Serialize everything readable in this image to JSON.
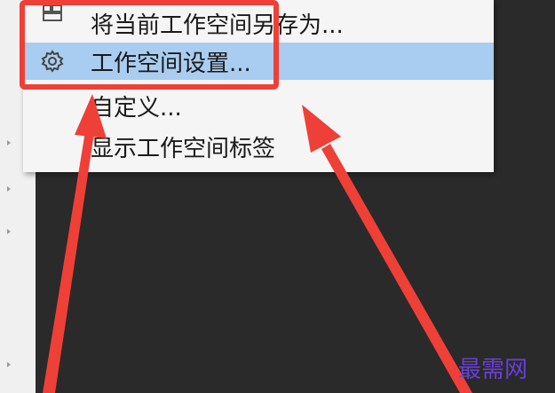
{
  "menu": {
    "items": [
      {
        "label": "将当前工作空间另存为...",
        "icon": "save-workspace-icon",
        "state": "partially-visible"
      },
      {
        "label": "工作空间设置...",
        "icon": "gear-icon",
        "state": "highlighted"
      },
      {
        "label": "自定义...",
        "icon": "",
        "state": "normal"
      },
      {
        "label": "显示工作空间标签",
        "icon": "",
        "state": "normal"
      }
    ]
  },
  "annotations": {
    "box_color": "#ee4037",
    "arrow_color": "#ee4037"
  },
  "colors": {
    "menu_background": "#f5f5f5",
    "highlight": "#a9cdf0",
    "canvas_background": "#2a2a2a"
  },
  "watermark": {
    "text": "最需网",
    "color": "#6a3fd8"
  }
}
